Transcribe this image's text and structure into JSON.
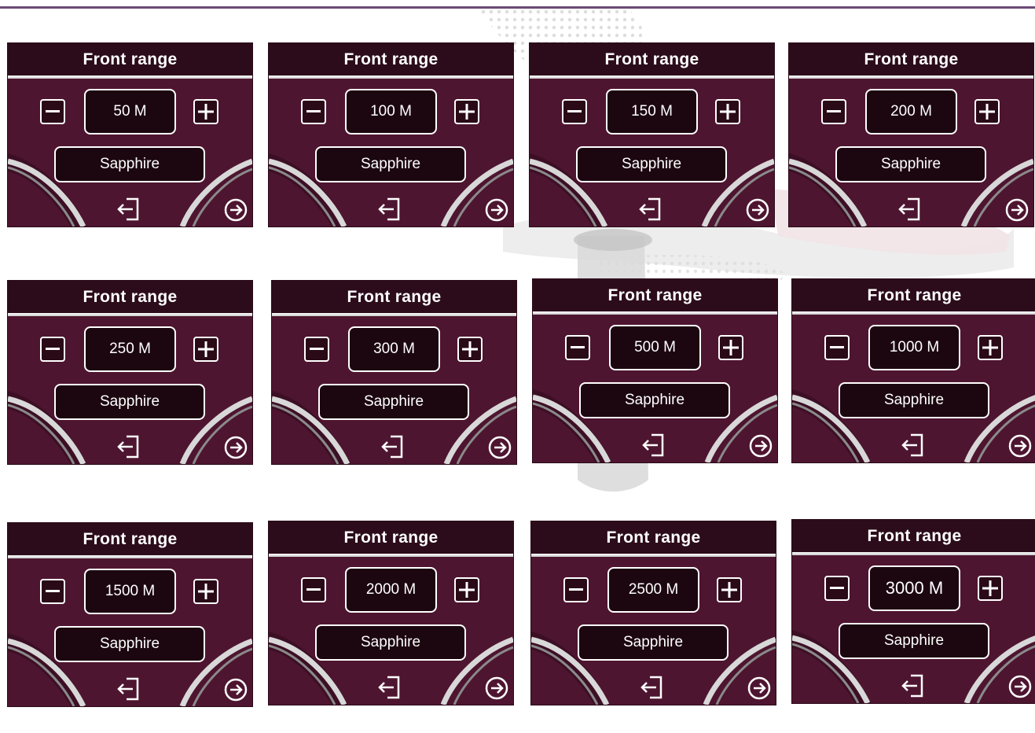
{
  "colors": {
    "panel_bg": "#4e1530",
    "header_bg": "#2c0c1b",
    "rule": "#6b4a78",
    "text": "#ffffff"
  },
  "icons": {
    "minus": "minus-icon",
    "plus": "plus-icon",
    "exit": "exit-icon",
    "next": "arrow-right-circle-icon"
  },
  "screens": [
    {
      "title": "Front range",
      "value": "50 M",
      "mode": "Sapphire"
    },
    {
      "title": "Front range",
      "value": "100 M",
      "mode": "Sapphire"
    },
    {
      "title": "Front range",
      "value": "150 M",
      "mode": "Sapphire"
    },
    {
      "title": "Front range",
      "value": "200 M",
      "mode": "Sapphire"
    },
    {
      "title": "Front range",
      "value": "250 M",
      "mode": "Sapphire"
    },
    {
      "title": "Front range",
      "value": "300 M",
      "mode": "Sapphire"
    },
    {
      "title": "Front range",
      "value": "500 M",
      "mode": "Sapphire"
    },
    {
      "title": "Front range",
      "value": "1000 M",
      "mode": "Sapphire"
    },
    {
      "title": "Front range",
      "value": "1500 M",
      "mode": "Sapphire"
    },
    {
      "title": "Front range",
      "value": "2000 M",
      "mode": "Sapphire"
    },
    {
      "title": "Front range",
      "value": "2500 M",
      "mode": "Sapphire"
    },
    {
      "title": "Front range",
      "value": "3000 M",
      "mode": "Sapphire"
    }
  ]
}
